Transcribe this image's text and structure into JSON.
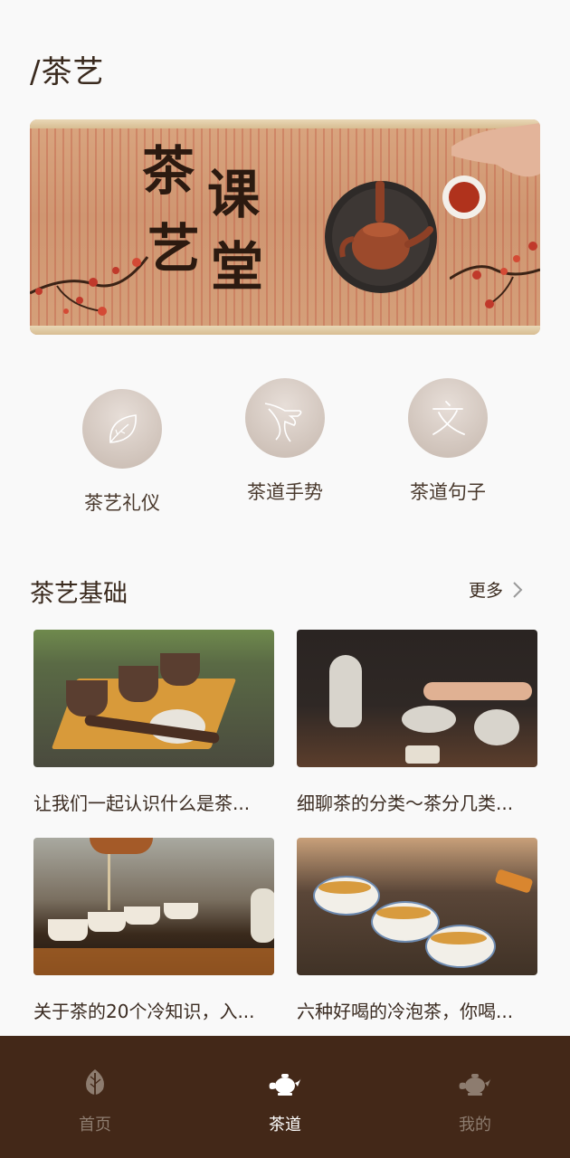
{
  "header": {
    "title": "/茶艺"
  },
  "banner": {
    "line1": "茶",
    "line2": "艺",
    "line3": "课",
    "line4": "堂"
  },
  "categories": [
    {
      "label": "茶艺礼仪",
      "icon": "leaf-icon"
    },
    {
      "label": "茶道手势",
      "icon": "hand-icon"
    },
    {
      "label": "茶道句子",
      "icon": "text-icon"
    }
  ],
  "section": {
    "title": "茶艺基础",
    "more_label": "更多"
  },
  "articles": [
    {
      "title": "让我们一起认识什么是茶..."
    },
    {
      "title": "细聊茶的分类～茶分几类..."
    },
    {
      "title": "关于茶的20个冷知识，入..."
    },
    {
      "title": "六种好喝的冷泡茶，你喝..."
    }
  ],
  "tabbar": {
    "items": [
      {
        "label": "首页",
        "icon": "leaf-icon",
        "active": false
      },
      {
        "label": "茶道",
        "icon": "teapot-icon",
        "active": true
      },
      {
        "label": "我的",
        "icon": "teapot-icon",
        "active": false
      }
    ]
  },
  "colors": {
    "tabbar_bg": "#432818",
    "text_primary": "#3a2a1e",
    "tab_inactive": "#8d7c6f",
    "tab_active": "#ffffff"
  }
}
